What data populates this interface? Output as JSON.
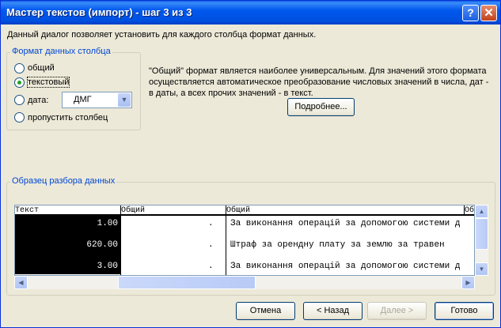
{
  "window": {
    "title": "Мастер текстов (импорт) - шаг 3 из 3",
    "help": "?",
    "close": "✕"
  },
  "description": "Данный диалог позволяет установить для каждого столбца формат данных.",
  "format_group": {
    "legend": "Формат данных столбца",
    "options": [
      "общий",
      "текстовый",
      "дата:",
      "пропустить столбец"
    ],
    "selected": "текстовый",
    "date_format": "ДМГ"
  },
  "info": {
    "lines": [
      "\"Общий\" формат является наиболее универсальным. Для значений этого формата",
      "осуществляется автоматическое преобразование числовых значений в числа, дат -",
      "в даты, а всех прочих значений - в текст."
    ],
    "more_button": "Подробнее..."
  },
  "preview": {
    "legend": "Образец разбора данных",
    "headers": [
      "Текст",
      "Общий",
      "Общий",
      "Общий"
    ],
    "rows": [
      [
        "1.00",
        ".",
        "За виконання операцій за допомогою системи д"
      ],
      [
        "620.00",
        ".",
        "Штраф  за орендну плату за землю  за травен"
      ],
      [
        "3.00",
        ".",
        "За виконання операцій за допомогою системи д"
      ]
    ]
  },
  "buttons": {
    "cancel": "Отмена",
    "back": "< Назад",
    "next": "Далее >",
    "finish": "Готово"
  }
}
